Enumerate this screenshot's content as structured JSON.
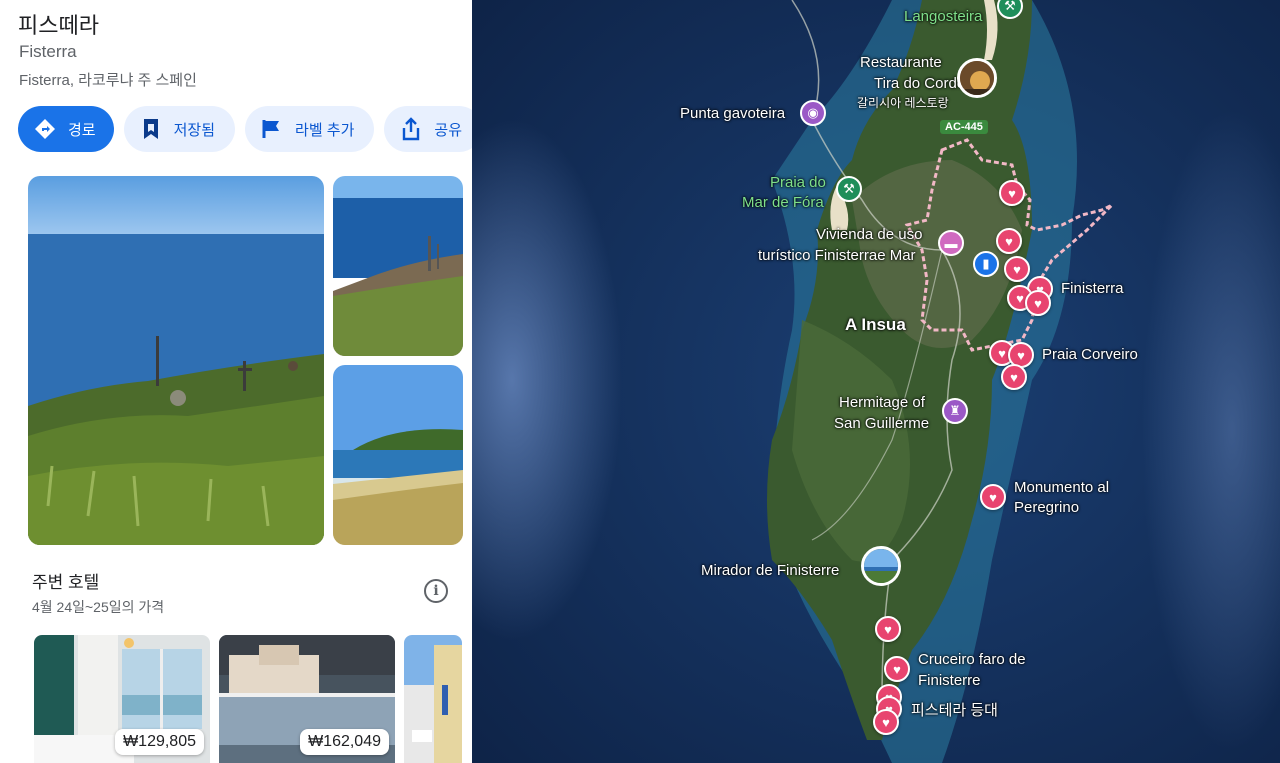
{
  "place": {
    "title": "피스떼라",
    "subtitle": "Fisterra",
    "address": "Fisterra, 라코루냐 주 스페인"
  },
  "actions": [
    {
      "label": "경로",
      "icon": "directions-icon"
    },
    {
      "label": "저장됨",
      "icon": "bookmark-icon"
    },
    {
      "label": "라벨 추가",
      "icon": "flag-icon"
    },
    {
      "label": "공유",
      "icon": "share-icon"
    }
  ],
  "hotels": {
    "title": "주변 호텔",
    "date_range": "4월 24일~25일의 가격",
    "items": [
      {
        "price": "₩129,805"
      },
      {
        "price": "₩162,049"
      },
      {
        "price": ""
      }
    ]
  },
  "map": {
    "road_badge": "AC-445",
    "labels": [
      {
        "text": "Langosteira",
        "style": "green"
      },
      {
        "text": "Restaurante",
        "style": "white"
      },
      {
        "text": "Tira do Cordel",
        "style": "white"
      },
      {
        "text": "갈리시아 레스토랑",
        "style": "white"
      },
      {
        "text": "Punta gavoteira",
        "style": "white"
      },
      {
        "text": "Praia do",
        "style": "green"
      },
      {
        "text": "Mar de Fóra",
        "style": "green"
      },
      {
        "text": "Vivienda de uso",
        "style": "white"
      },
      {
        "text": "turístico Finisterrae Mar",
        "style": "white"
      },
      {
        "text": "Finisterra",
        "style": "white"
      },
      {
        "text": "A Insua",
        "style": "big"
      },
      {
        "text": "Praia Corveiro",
        "style": "white"
      },
      {
        "text": "Hermitage of",
        "style": "white"
      },
      {
        "text": "San Guillerme",
        "style": "white"
      },
      {
        "text": "Monumento al",
        "style": "white"
      },
      {
        "text": "Peregrino",
        "style": "white"
      },
      {
        "text": "Mirador de Finisterre",
        "style": "white"
      },
      {
        "text": "Cruceiro faro de",
        "style": "white"
      },
      {
        "text": "Finisterre",
        "style": "white"
      },
      {
        "text": "피스테라 등대",
        "style": "white"
      }
    ]
  },
  "colors": {
    "primary_button": "#1a73e8",
    "tonal_button": "#e8f0fe",
    "saved_pin": "#e8446f",
    "boundary": "#f2b8c6"
  }
}
